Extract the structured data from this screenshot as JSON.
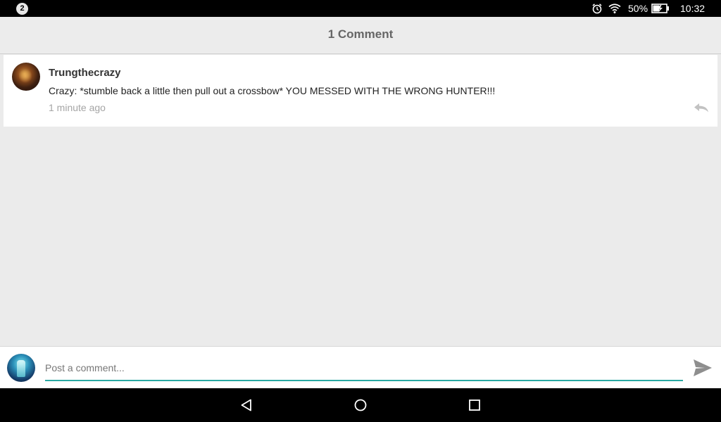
{
  "status_bar": {
    "notification_count": "2",
    "battery": "50%",
    "time": "10:32",
    "icons": [
      "alarm-icon",
      "wifi-icon",
      "battery-charging-icon"
    ]
  },
  "header": {
    "title": "1 Comment"
  },
  "comments": [
    {
      "author": "Trungthecrazy",
      "text": "Crazy: *stumble back a little then pull out a crossbow* YOU MESSED WITH THE WRONG HUNTER!!!",
      "time": "1 minute ago"
    }
  ],
  "composer": {
    "placeholder": "Post a comment...",
    "value": ""
  },
  "colors": {
    "accent": "#2aa9a3",
    "background": "#ebebeb"
  },
  "nav_bar": {
    "icons": [
      "back-icon",
      "home-icon",
      "recents-icon"
    ]
  }
}
